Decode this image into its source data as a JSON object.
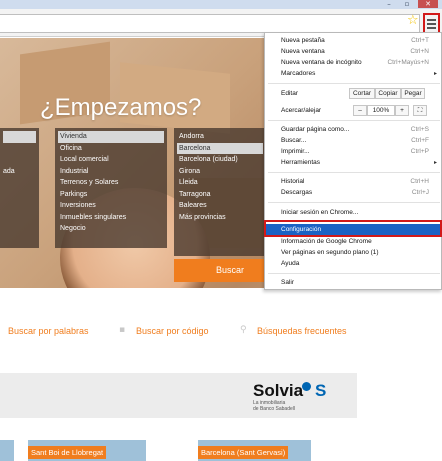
{
  "window": {
    "minimize": "–",
    "maximize": "▫",
    "close": "✕"
  },
  "hero": {
    "title": "¿Empezamos?",
    "left_col": [
      "",
      "ada"
    ],
    "property_types": [
      "Vivienda",
      "Oficina",
      "Local comercial",
      "Industrial",
      "Terrenos y Solares",
      "Parkings",
      "Inversiones",
      "Inmuebles singulares",
      "Negocio"
    ],
    "provinces": [
      "Andorra",
      "Barcelona",
      "Barcelona (ciudad)",
      "Girona",
      "Lleida",
      "Tarragona",
      "Baleares",
      "Más provincias"
    ],
    "search_label": "Buscar"
  },
  "links": {
    "by_words": "Buscar por palabras",
    "by_code": "Buscar por código",
    "frequent": "Búsquedas frecuentes"
  },
  "banner": {
    "brand": "Solvia",
    "logo": "S",
    "tagline_1": "La inmobiliaria",
    "tagline_2": "de Banco Sabadell"
  },
  "cards": [
    "Sant Boi de Llobregat",
    "Barcelona (Sant Gervasi)"
  ],
  "menu": {
    "new_tab": "Nueva pestaña",
    "new_tab_sc": "Ctrl+T",
    "new_window": "Nueva ventana",
    "new_window_sc": "Ctrl+N",
    "incognito": "Nueva ventana de incógnito",
    "incognito_sc": "Ctrl+Mayús+N",
    "bookmarks": "Marcadores",
    "edit": "Editar",
    "cut": "Cortar",
    "copy": "Copiar",
    "paste": "Pegar",
    "zoom": "Acercar/alejar",
    "zoom_minus": "–",
    "zoom_value": "100%",
    "zoom_plus": "+",
    "save_page": "Guardar página como...",
    "save_page_sc": "Ctrl+S",
    "find": "Buscar...",
    "find_sc": "Ctrl+F",
    "print": "Imprimir...",
    "print_sc": "Ctrl+P",
    "tools": "Herramientas",
    "history": "Historial",
    "history_sc": "Ctrl+H",
    "downloads": "Descargas",
    "downloads_sc": "Ctrl+J",
    "sign_in": "Iniciar sesión en Chrome...",
    "settings": "Configuración",
    "about": "Información de Google Chrome",
    "background_pages": "Ver páginas en segundo plano (1)",
    "help": "Ayuda",
    "exit": "Salir"
  },
  "colors": {
    "accent_orange": "#f07d1e",
    "menu_highlight": "#1b62c4",
    "annotation_red": "#d21919",
    "brand_blue": "#0066b3"
  }
}
